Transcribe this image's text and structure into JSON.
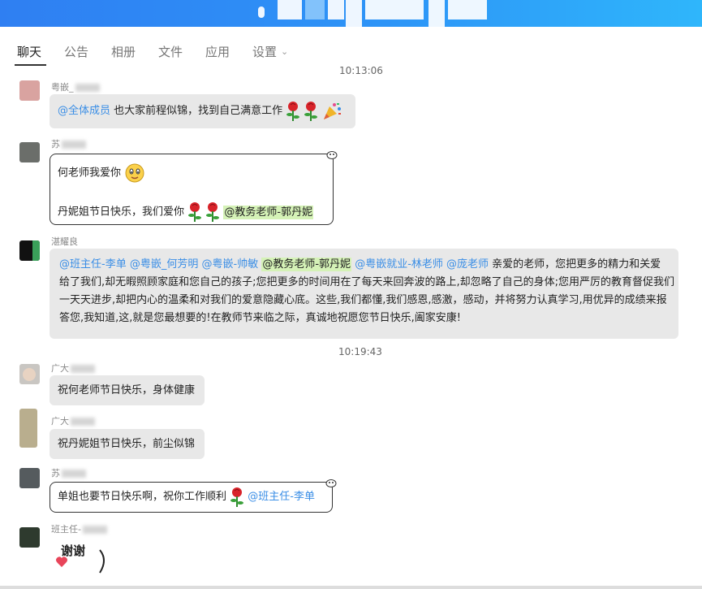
{
  "tabs": [
    {
      "label": "聊天",
      "active": true
    },
    {
      "label": "公告",
      "active": false
    },
    {
      "label": "相册",
      "active": false
    },
    {
      "label": "文件",
      "active": false
    },
    {
      "label": "应用",
      "active": false
    },
    {
      "label": "设置",
      "active": false
    }
  ],
  "timestamps": [
    "10:13:06",
    "10:19:43"
  ],
  "messages": [
    {
      "sender": "粤嵌_",
      "mention": "@全体成员",
      "text": " 也大家前程似锦，找到自己满意工作 "
    },
    {
      "sender": "苏",
      "line1": "何老师我爱你",
      "line2": "丹妮姐节日快乐，我们爱你 ",
      "mention": "@教务老师-郭丹妮"
    },
    {
      "sender": "湛耀良",
      "mentions": [
        "@班主任-李单",
        "@粤嵌_何芳明",
        "@粤嵌-帅敏",
        "@教务老师-郭丹妮",
        "@粤嵌就业-林老师",
        "@庞老师"
      ],
      "lines": [
        " 亲爱的老师，您把更多的精力和关爱",
        "给了我们,却无暇照顾家庭和您自己的孩子;您把更多的时间用在了每天来回奔波的路上,却忽略了自己的身体;您用严厉的教育督促我们",
        "一天天进步,却把内心的温柔和对我们的爱意隐藏心底。这些,我们都懂,我们感恩,感激，感动，并将努力认真学习,用优异的成绩来报",
        "答您,我知道,这,就是您最想要的!在教师节来临之际，真诚地祝愿您节日快乐,阖家安康!"
      ]
    },
    {
      "sender": "广大",
      "text": "祝何老师节日快乐，身体健康"
    },
    {
      "sender": "广大",
      "text": "祝丹妮姐节日快乐，前尘似锦"
    },
    {
      "sender": "苏",
      "text": "单姐也要节日快乐啊，祝你工作顺利 ",
      "mention": "@班主任-李单"
    },
    {
      "sender": "班主任-",
      "sticker_text": "谢谢"
    }
  ],
  "colors": {
    "mention": "#3a8ee6",
    "highlight": "#d5f2b7",
    "bubble": "#e8e8e8",
    "titlebar": "#2d94f7"
  }
}
